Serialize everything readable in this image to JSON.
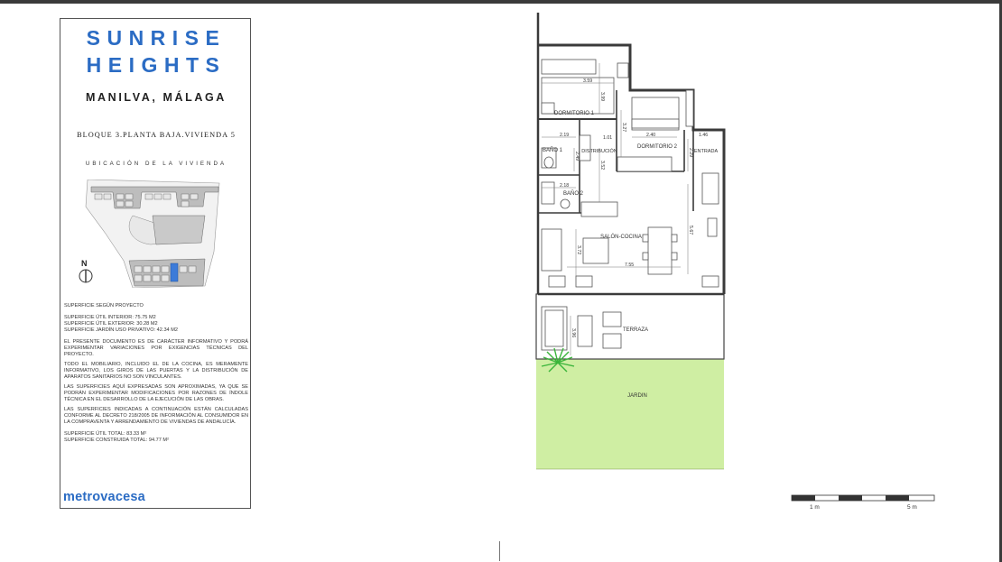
{
  "panel": {
    "title_line1": "SUNRISE",
    "title_line2": "HEIGHTS",
    "location": "MANILVA, MÁLAGA",
    "unit": "BLOQUE 3.PLANTA BAJA.VIVIENDA 5",
    "location_label": "UBICACIÓN DE LA VIVIENDA",
    "north": "N",
    "surface_header": "SUPERFICIE SEGÚN PROYECTO",
    "surface_interior": "SUPERFICIE ÚTIL INTERIOR: 75.75 M2",
    "surface_exterior": "SUPERFICIE ÚTIL EXTERIOR: 30.28 M2",
    "surface_garden": "SUPERFICIE JARDÍN USO PRIVATIVO: 42.34 M2",
    "note1": "EL PRESENTE DOCUMENTO ES DE CARÁCTER INFORMATIVO Y PODRÁ EXPERIMENTAR VARIACIONES POR EXIGENCIAS TÉCNICAS DEL PROYECTO.",
    "note2": "TODO EL MOBILIARIO, INCLUIDO EL DE LA COCINA, ES MERAMENTE INFORMATIVO, LOS GIROS DE LAS PUERTAS Y LA DISTRIBUCIÓN DE APARATOS SANITARIOS NO SON VINCULANTES.",
    "note3": "LAS SUPERFICIES AQUÍ EXPRESADAS SON APROXIMADAS, YA QUE SE PODRÁN EXPERIMENTAR MODIFICACIONES POR RAZONES DE ÍNDOLE TÉCNICA EN EL DESARROLLO DE LA EJECUCIÓN DE LAS OBRAS.",
    "note4": "LAS SUPERFICIES INDICADAS A CONTINUACIÓN ESTÁN CALCULADAS CONFORME AL DECRETO 218/2005 DE INFORMACIÓN AL CONSUMIDOR EN LA COMPRAVENTA Y ARRENDAMIENTO DE VIVIENDAS DE ANDALUCÍA.",
    "total_util": "SUPERFICIE ÚTIL TOTAL: 83.33 M²",
    "total_built": "SUPERFICIE CONSTRUIDA TOTAL: 94.77 M²",
    "brand": "metrovacesa"
  },
  "plan": {
    "rooms": {
      "dormitorio1": "DORMITORIO 1",
      "dormitorio2": "DORMITORIO 2",
      "bano1": "BAÑO 1",
      "bano2": "BAÑO 2",
      "distribucion": "DISTRIBUCIÓN",
      "entrada": "ENTRADA",
      "salon": "SALÓN-COCINA",
      "terraza": "TERRAZA",
      "jardin": "JARDIN"
    },
    "dims": {
      "d1": "3.59",
      "d2": "3.99",
      "d3": "3.27",
      "d4": "2.19",
      "d5": "1.01",
      "d6": "2.40",
      "d7": "1.46",
      "d8": "2.49",
      "d9": "3.52",
      "d10": "2.29",
      "d11": "2.18",
      "d12": "5.67",
      "d13": "3.72",
      "d14": "7.55",
      "d15": "3.96"
    },
    "colors": {
      "garden": "#cfeea3",
      "plant": "#3bb53b",
      "wall": "#3a3a3a"
    }
  },
  "scale": {
    "label_1m": "1 m",
    "label_5m": "5 m"
  }
}
